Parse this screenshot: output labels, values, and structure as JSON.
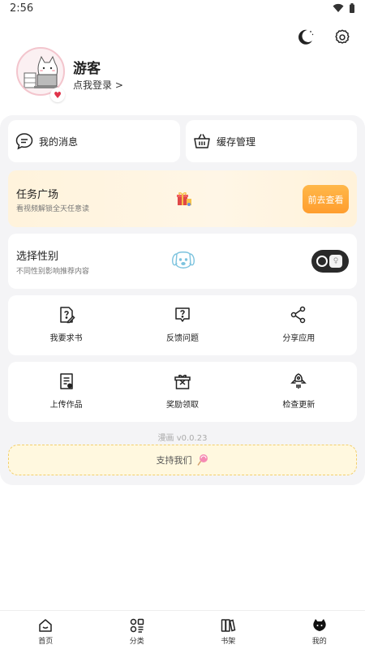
{
  "status_bar": {
    "time": "2:56"
  },
  "profile": {
    "username": "游客",
    "login_link": "点我登录 >"
  },
  "cards": {
    "messages": "我的消息",
    "cache": "缓存管理"
  },
  "task": {
    "title": "任务广场",
    "subtitle": "看视频解锁全天任意读",
    "button": "前去查看"
  },
  "gender": {
    "title": "选择性别",
    "subtitle": "不同性别影响推荐内容",
    "toggle_symbol": "♀"
  },
  "grid1": [
    {
      "label": "我要求书",
      "icon": "edit-doc-icon"
    },
    {
      "label": "反馈问题",
      "icon": "question-box-icon"
    },
    {
      "label": "分享应用",
      "icon": "share-icon"
    }
  ],
  "grid2": [
    {
      "label": "上传作品",
      "icon": "upload-doc-icon"
    },
    {
      "label": "奖励领取",
      "icon": "gift-box-icon"
    },
    {
      "label": "检查更新",
      "icon": "rocket-icon"
    }
  ],
  "version": "漫画 v0.0.23",
  "support": {
    "label": "支持我们",
    "icon": "lollipop-icon"
  },
  "nav": [
    {
      "label": "首页",
      "icon": "home-icon"
    },
    {
      "label": "分类",
      "icon": "category-icon"
    },
    {
      "label": "书架",
      "icon": "bookshelf-icon"
    },
    {
      "label": "我的",
      "icon": "profile-cat-icon"
    }
  ],
  "colors": {
    "accent_orange": "#ff9d2e",
    "panel_bg": "#f4f4f6",
    "support_bg": "#fff8df"
  }
}
